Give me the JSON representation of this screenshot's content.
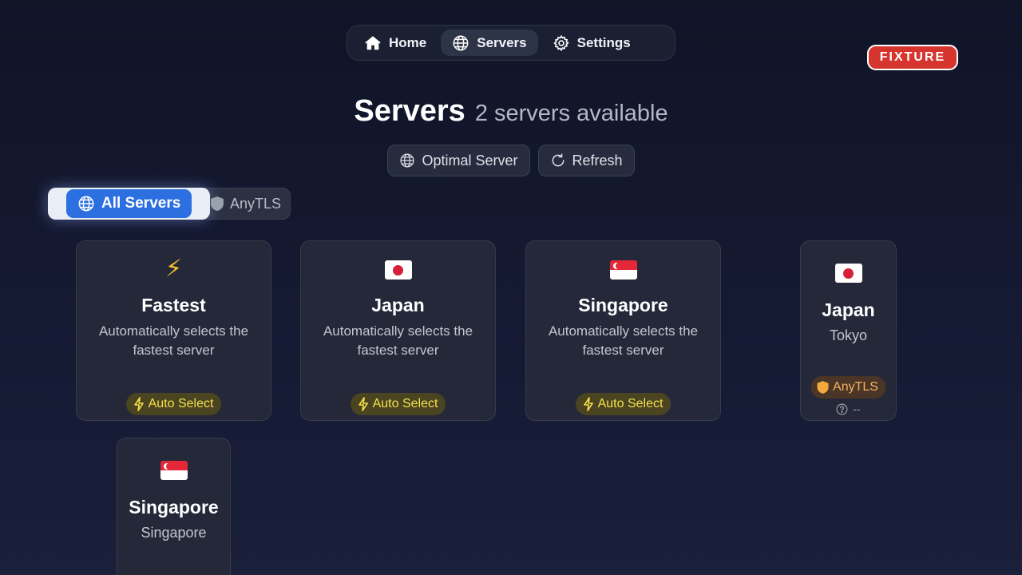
{
  "nav": {
    "items": [
      {
        "label": "Home",
        "icon": "home-icon",
        "active": false
      },
      {
        "label": "Servers",
        "icon": "globe-icon",
        "active": true
      },
      {
        "label": "Settings",
        "icon": "gear-icon",
        "active": false
      }
    ]
  },
  "fixture_badge": "FIXTURE",
  "header": {
    "title": "Servers",
    "subtitle": "2 servers available"
  },
  "actions": {
    "optimal_label": "Optimal Server",
    "refresh_label": "Refresh"
  },
  "filters": [
    {
      "label": "All Servers",
      "icon": "globe-icon",
      "active": true
    },
    {
      "label": "AnyTLS",
      "icon": "shield-icon",
      "active": false
    }
  ],
  "auto_cards": [
    {
      "icon": "lightning-icon",
      "name": "Fastest",
      "description": "Automatically selects the fastest server",
      "tag": "Auto Select"
    },
    {
      "icon": "flag-japan",
      "name": "Japan",
      "description": "Automatically selects the fastest server",
      "tag": "Auto Select"
    },
    {
      "icon": "flag-singapore",
      "name": "Singapore",
      "description": "Automatically selects the fastest server",
      "tag": "Auto Select"
    }
  ],
  "server_cards": [
    {
      "icon": "flag-japan",
      "name": "Japan",
      "city": "Tokyo",
      "protocol": "AnyTLS",
      "latency": "--"
    },
    {
      "icon": "flag-singapore",
      "name": "Singapore",
      "city": "Singapore"
    }
  ],
  "colors": {
    "accent": "#2b6fe0",
    "auto_tag": "#f6e04c",
    "protocol_tag": "#f4b45e",
    "fixture": "#d6352e"
  }
}
